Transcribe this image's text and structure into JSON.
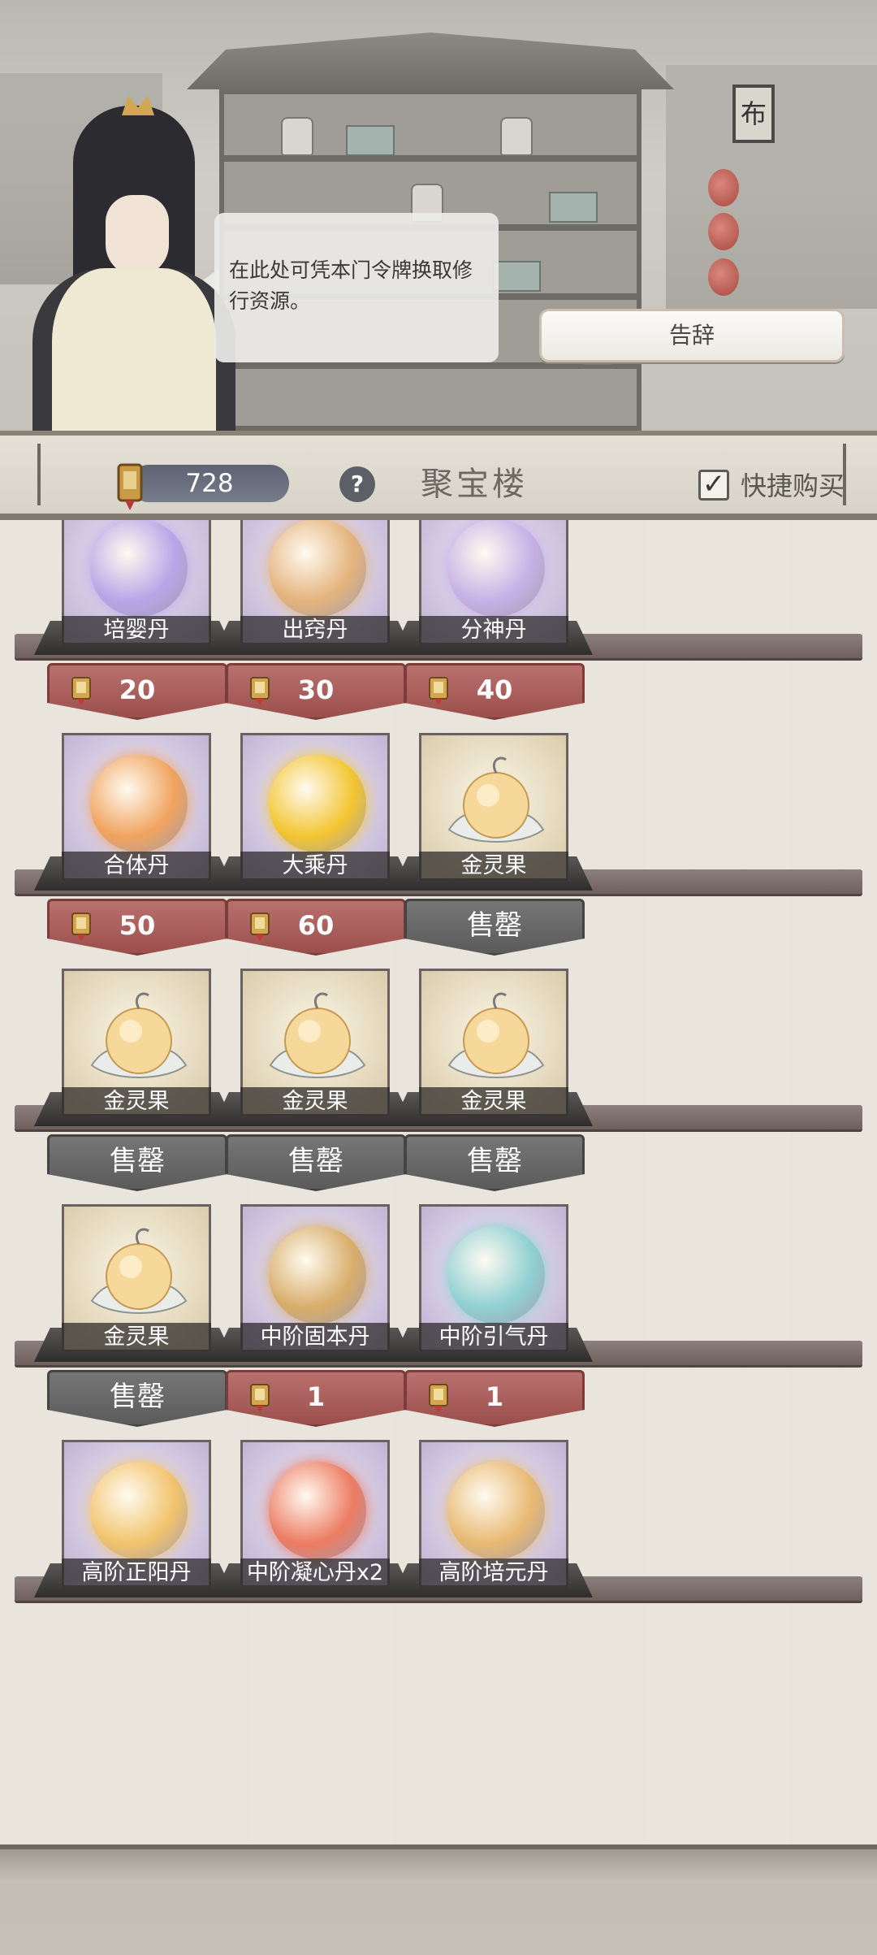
{
  "dialog": {
    "speech": "在此处可凭本门令牌换取修行资源。",
    "farewell_label": "告辞"
  },
  "scene": {
    "sign_text": "布"
  },
  "header": {
    "token_count": "728",
    "help_label": "?",
    "title": "聚宝楼",
    "quickbuy_label": "快捷购买",
    "quickbuy_checked": true
  },
  "shop": {
    "rows": [
      {
        "items": [
          {
            "name": "培婴丹",
            "price": "20",
            "status": "available",
            "kind": "orb",
            "color": "#b7a5e8"
          },
          {
            "name": "出窍丹",
            "price": "30",
            "status": "available",
            "kind": "orb",
            "color": "#e4b37c"
          },
          {
            "name": "分神丹",
            "price": "40",
            "status": "available",
            "kind": "orb",
            "color": "#c6b0e6"
          }
        ]
      },
      {
        "items": [
          {
            "name": "合体丹",
            "price": "50",
            "status": "available",
            "kind": "orb",
            "color": "#f0a35e"
          },
          {
            "name": "大乘丹",
            "price": "60",
            "status": "available",
            "kind": "orb",
            "color": "#f3c530"
          },
          {
            "name": "金灵果",
            "price": "售罄",
            "status": "soldout",
            "kind": "fruit",
            "color": "#f6d89a"
          }
        ]
      },
      {
        "items": [
          {
            "name": "金灵果",
            "price": "售罄",
            "status": "soldout",
            "kind": "fruit",
            "color": "#f6d89a"
          },
          {
            "name": "金灵果",
            "price": "售罄",
            "status": "soldout",
            "kind": "fruit",
            "color": "#f6d89a"
          },
          {
            "name": "金灵果",
            "price": "售罄",
            "status": "soldout",
            "kind": "fruit",
            "color": "#f6d89a"
          }
        ]
      },
      {
        "items": [
          {
            "name": "金灵果",
            "price": "售罄",
            "status": "soldout",
            "kind": "fruit",
            "color": "#f6d89a"
          },
          {
            "name": "中阶固本丹",
            "price": "1",
            "status": "available",
            "kind": "orb",
            "color": "#d8ad6a"
          },
          {
            "name": "中阶引气丹",
            "price": "1",
            "status": "available",
            "kind": "orb",
            "color": "#8fd0d3"
          }
        ]
      },
      {
        "items": [
          {
            "name": "高阶正阳丹",
            "price": "",
            "status": "partial",
            "kind": "orb",
            "color": "#f2c36c"
          },
          {
            "name": "中阶凝心丹x2",
            "price": "",
            "status": "partial",
            "kind": "orb",
            "color": "#ec7b62"
          },
          {
            "name": "高阶培元丹",
            "price": "",
            "status": "partial",
            "kind": "orb",
            "color": "#e8b972"
          }
        ]
      }
    ]
  },
  "colors": {
    "price_red": "#a3534f",
    "soldout_gray": "#666666",
    "card_purple": "#bbaed0",
    "card_tan": "#d7c9a6"
  }
}
